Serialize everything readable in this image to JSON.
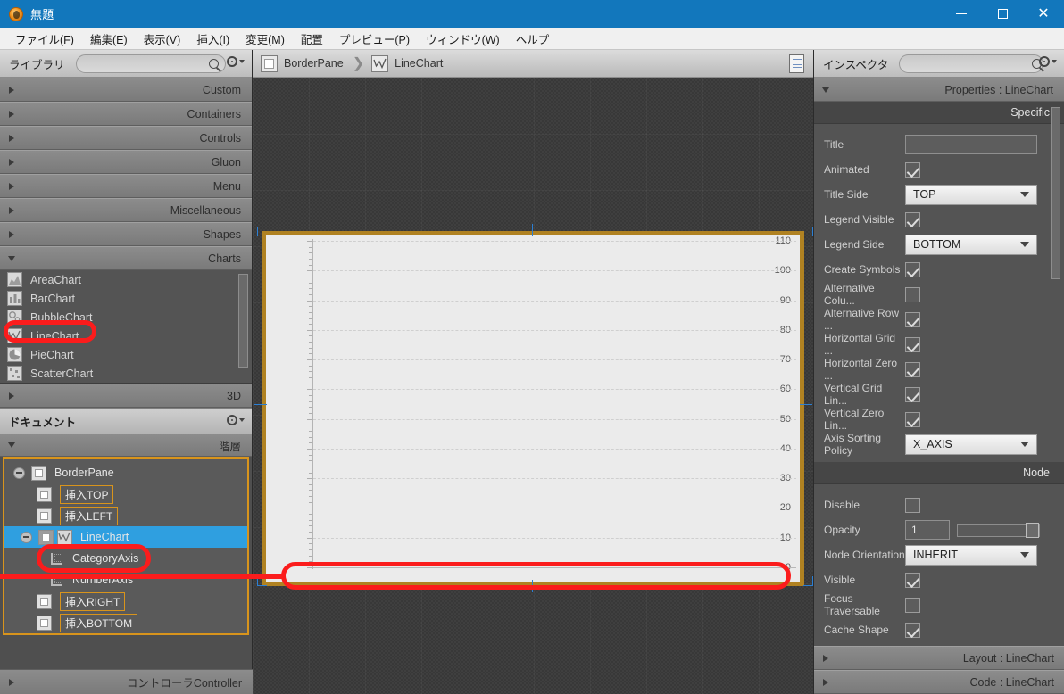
{
  "window": {
    "title": "無題",
    "app_icon": "scenebuilder-icon",
    "minimize_label": "—",
    "maximize_label": "□",
    "close_label": "✕"
  },
  "menubar": {
    "items": [
      {
        "label": "ファイル(F)"
      },
      {
        "label": "編集(E)"
      },
      {
        "label": "表示(V)"
      },
      {
        "label": "挿入(I)"
      },
      {
        "label": "変更(M)"
      },
      {
        "label": "配置"
      },
      {
        "label": "プレビュー(P)"
      },
      {
        "label": "ウィンドウ(W)"
      },
      {
        "label": "ヘルプ"
      }
    ]
  },
  "library": {
    "title": "ライブラリ",
    "search_placeholder": "",
    "search_value": "",
    "sections": [
      {
        "label": "Custom",
        "expanded": false
      },
      {
        "label": "Containers",
        "expanded": false
      },
      {
        "label": "Controls",
        "expanded": false
      },
      {
        "label": "Gluon",
        "expanded": false
      },
      {
        "label": "Menu",
        "expanded": false
      },
      {
        "label": "Miscellaneous",
        "expanded": false
      },
      {
        "label": "Shapes",
        "expanded": false
      },
      {
        "label": "Charts",
        "expanded": true
      }
    ],
    "items": [
      {
        "label": "AreaChart",
        "icon": "area-chart-icon"
      },
      {
        "label": "BarChart",
        "icon": "bar-chart-icon"
      },
      {
        "label": "BubbleChart",
        "icon": "bubble-chart-icon"
      },
      {
        "label": "LineChart",
        "icon": "line-chart-icon",
        "highlighted": true
      },
      {
        "label": "PieChart",
        "icon": "pie-chart-icon"
      },
      {
        "label": "ScatterChart",
        "icon": "scatter-chart-icon"
      }
    ],
    "section_3d": {
      "label": "3D",
      "expanded": false
    }
  },
  "document": {
    "title": "ドキュメント",
    "hierarchy_label": "階層",
    "controller_label": "コントローラController",
    "tree": [
      {
        "label": "BorderPane",
        "depth": 0,
        "kind": "node",
        "expanded": true,
        "selected": false
      },
      {
        "label": "挿入TOP",
        "depth": 1,
        "kind": "chip",
        "selected": false
      },
      {
        "label": "挿入LEFT",
        "depth": 1,
        "kind": "chip",
        "selected": false
      },
      {
        "label": "LineChart",
        "depth": 1,
        "kind": "node",
        "expanded": true,
        "selected": true
      },
      {
        "label": "CategoryAxis",
        "depth": 2,
        "kind": "axis",
        "selected": false,
        "annotated": true
      },
      {
        "label": "NumberAxis",
        "depth": 2,
        "kind": "axis",
        "selected": false
      },
      {
        "label": "挿入RIGHT",
        "depth": 1,
        "kind": "chip",
        "selected": false
      },
      {
        "label": "挿入BOTTOM",
        "depth": 1,
        "kind": "chip",
        "selected": false
      }
    ]
  },
  "content": {
    "breadcrumb": [
      {
        "label": "BorderPane",
        "icon": "borderpane-icon"
      },
      {
        "label": "LineChart",
        "icon": "linechart-icon"
      }
    ],
    "separator": "❯",
    "doc_toggle_icon": "document-panel-icon",
    "selected_node": "LineChart"
  },
  "chart_data": {
    "type": "line",
    "title": "",
    "xlabel": "",
    "ylabel": "",
    "categories": [],
    "series": [],
    "yticks": [
      0,
      10,
      20,
      30,
      40,
      50,
      60,
      70,
      80,
      90,
      100,
      110
    ],
    "ylim": [
      0,
      110
    ],
    "grid": true,
    "legend_position": "bottom",
    "legend_entries": []
  },
  "inspector": {
    "title": "インスペクタ",
    "search_placeholder": "",
    "search_value": "",
    "sections": {
      "properties": "Properties : LineChart",
      "layout": "Layout : LineChart",
      "code": "Code : LineChart"
    },
    "specific_header": "Specific",
    "node_header": "Node",
    "specific": [
      {
        "label": "Title",
        "type": "text",
        "value": ""
      },
      {
        "label": "Animated",
        "type": "check",
        "value": true
      },
      {
        "label": "Title Side",
        "type": "combo",
        "value": "TOP"
      },
      {
        "label": "Legend Visible",
        "type": "check",
        "value": true
      },
      {
        "label": "Legend Side",
        "type": "combo",
        "value": "BOTTOM"
      },
      {
        "label": "Create Symbols",
        "type": "check",
        "value": true
      },
      {
        "label": "Alternative Colu...",
        "type": "check",
        "value": false
      },
      {
        "label": "Alternative Row ...",
        "type": "check",
        "value": true
      },
      {
        "label": "Horizontal Grid ...",
        "type": "check",
        "value": true
      },
      {
        "label": "Horizontal Zero ...",
        "type": "check",
        "value": true
      },
      {
        "label": "Vertical Grid Lin...",
        "type": "check",
        "value": true
      },
      {
        "label": "Vertical Zero Lin...",
        "type": "check",
        "value": true
      },
      {
        "label": "Axis Sorting Policy",
        "type": "combo",
        "value": "X_AXIS"
      }
    ],
    "node": [
      {
        "label": "Disable",
        "type": "check",
        "value": false
      },
      {
        "label": "Opacity",
        "type": "text-slider",
        "value": "1"
      },
      {
        "label": "Node Orientation",
        "type": "combo",
        "value": "INHERIT"
      },
      {
        "label": "Visible",
        "type": "check",
        "value": true
      },
      {
        "label": "Focus Traversable",
        "type": "check",
        "value": false
      },
      {
        "label": "Cache Shape",
        "type": "check",
        "value": true
      }
    ]
  },
  "colors": {
    "titlebar": "#1277bc",
    "selection": "#2f9fe0",
    "selected_border": "#b08222",
    "annotation": "#fb1c1c",
    "panel": "#4f4f4f",
    "handle": "#2b7fd4"
  }
}
